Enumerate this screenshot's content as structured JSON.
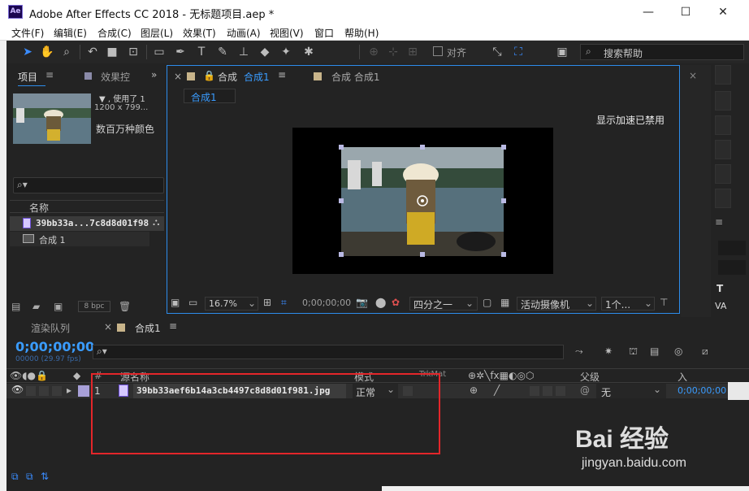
{
  "window": {
    "app_icon": "Ae",
    "title": "Adobe After Effects CC 2018 - 无标题项目.aep *",
    "minimize": "—",
    "maximize": "☐",
    "close": "✕"
  },
  "menu": [
    "文件(F)",
    "编辑(E)",
    "合成(C)",
    "图层(L)",
    "效果(T)",
    "动画(A)",
    "视图(V)",
    "窗口",
    "帮助(H)"
  ],
  "toolbar": {
    "snap_label": "对齐",
    "search_help": "搜索帮助"
  },
  "project_panel": {
    "tab_project": "项目",
    "tab_effects": "效果控",
    "usage": "▼ , 使用了 1",
    "dimensions": "1200 x 799...",
    "color_depth": "数百万种颜色",
    "col_name": "名称",
    "items": [
      {
        "name": "39bb33a...7c8d8d01f98",
        "type": "image"
      },
      {
        "name": "合成 1",
        "type": "comp"
      }
    ],
    "bpc": "8 bpc"
  },
  "viewer": {
    "tab_label": "合成",
    "tab_comp": "合成1",
    "tab2_label": "合成 合成1",
    "breadcrumb": "合成1",
    "accel_notice": "显示加速已禁用",
    "zoom": "16.7%",
    "timecode": "0;00;00;00",
    "resolution": "四分之一",
    "camera": "活动摄像机",
    "views": "1个..."
  },
  "timeline": {
    "tab_render": "渲染队列",
    "tab_comp": "合成1",
    "timecode": "0;00;00;00",
    "frame_info": "00000 (29.97 fps)",
    "col_index": "#",
    "col_source": "源名称",
    "col_mode": "模式",
    "col_trkmat": "TrkMat",
    "col_parent": "父级",
    "col_in": "入",
    "layers": [
      {
        "index": "1",
        "name": "39bb33aef6b14a3cb4497c8d8d01f981.jpg",
        "mode": "正常",
        "parent": "无",
        "in": "0;00;00;00"
      }
    ]
  },
  "watermark": {
    "brand": "Bai 经验",
    "url": "jingyan.baidu.com"
  },
  "colors": {
    "accent": "#2d8ceb",
    "timecode": "#3a9cff",
    "highlight_box": "#e3262a"
  }
}
